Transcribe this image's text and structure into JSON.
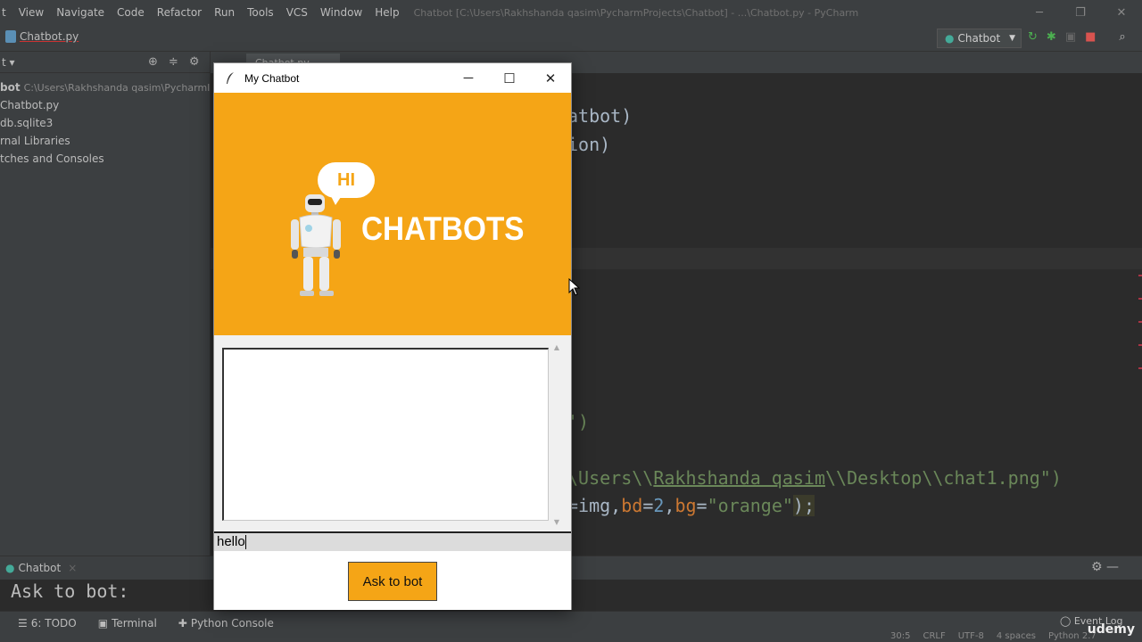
{
  "ide": {
    "menus": [
      "t",
      "View",
      "Navigate",
      "Code",
      "Refactor",
      "Run",
      "Tools",
      "VCS",
      "Window",
      "Help"
    ],
    "window_title": "Chatbot [C:\\Users\\Rakhshanda qasim\\PycharmProjects\\Chatbot] - ...\\Chatbot.py - PyCharm",
    "breadcrumb": "Chatbot.py",
    "run_config": "Chatbot",
    "tab_label": "Chatbot.py",
    "project_items": [
      {
        "label": "bot",
        "path": "C:\\Users\\Rakhshanda qasim\\PycharmI"
      },
      {
        "label": "Chatbot.py",
        "path": ""
      },
      {
        "label": "db.sqlite3",
        "path": ""
      },
      {
        "label": "rnal Libraries",
        "path": ""
      },
      {
        "label": "tches and Consoles",
        "path": ""
      }
    ],
    "code": {
      "line1": "atbot)",
      "line2": "ion)",
      "line3": "')",
      "line4_a": "\\Users\\\\",
      "line4_b": "Rakhshanda qasim",
      "line4_c": "\\\\Desktop\\\\chat1.png\")",
      "line5_a": "=img,",
      "line5_b": "bd",
      "line5_c": "=",
      "line5_d": "2",
      "line5_e": ",",
      "line5_f": "bg",
      "line5_g": "=",
      "line5_h": "\"orange\"",
      "line5_i": ");"
    },
    "run_tab": "Chatbot",
    "run_output": "Ask to bot:",
    "tool_windows": [
      "6: TODO",
      "Terminal",
      "Python Console"
    ],
    "event_log": "Event Log",
    "status": [
      "30:5",
      "CRLF",
      "UTF-8",
      "4 spaces",
      "Python 2.7"
    ],
    "watermark": "udemy"
  },
  "chatbot": {
    "title": "My Chatbot",
    "banner_bubble": "HI",
    "banner_text": "CHATBOTS",
    "banner_color": "#f5a516",
    "entry_value": "hello",
    "ask_button": "Ask to bot"
  }
}
